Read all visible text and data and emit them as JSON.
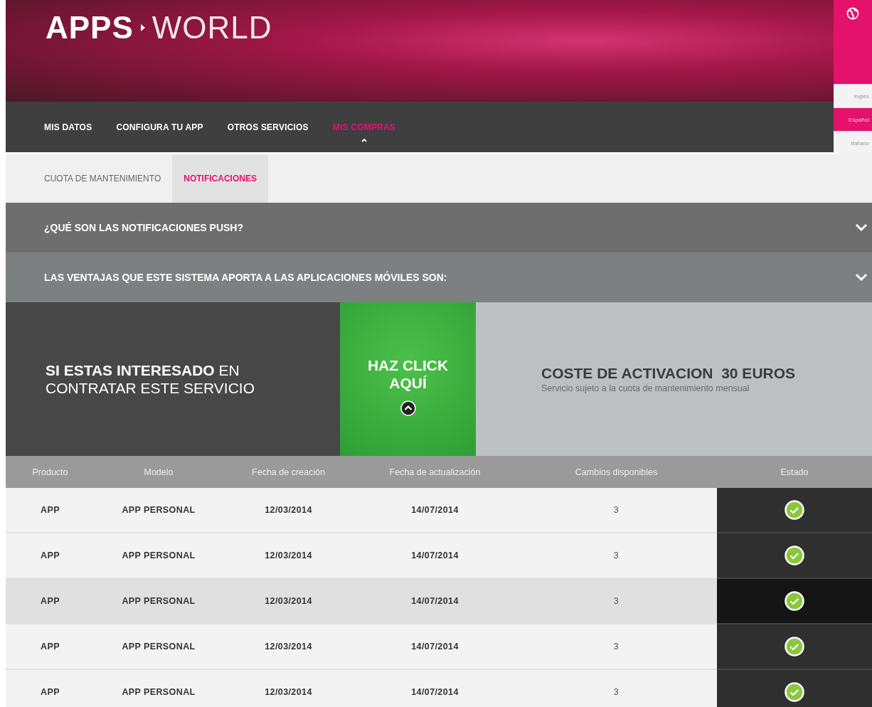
{
  "header": {
    "logo_bold": "APPS",
    "logo_light": "WORLD"
  },
  "languages": [
    {
      "label": "Inglés",
      "selected": false
    },
    {
      "label": "Español",
      "selected": true
    },
    {
      "label": "Italiano",
      "selected": false
    }
  ],
  "nav": [
    {
      "label": "MIS DATOS",
      "selected": false
    },
    {
      "label": "CONFIGURA TU APP",
      "selected": false
    },
    {
      "label": "OTROS SERVICIOS",
      "selected": false
    },
    {
      "label": "MIS COMPRAS",
      "selected": true
    }
  ],
  "subtabs": [
    {
      "label": "CUOTA DE MANTENIMIENTO",
      "selected": false
    },
    {
      "label": "NOTIFICACIONES",
      "selected": true
    }
  ],
  "accordions": [
    {
      "title": "¿QUÉ SON LAS NOTIFICACIONES PUSH?",
      "expanded": false
    },
    {
      "title": "LAS VENTAJAS QUE ESTE SISTEMA APORTA A LAS APLICACIONES MÓVILES SON:",
      "expanded": false
    }
  ],
  "promo": {
    "message": "**SI ESTAS INTERESADO** EN CONTRATAR ESTE SERVICIO",
    "cta": "HAZ CLICK AQUÍ",
    "price_title": "COSTE DE ACTIVACION  30 EUROS",
    "price_note": "Servicio sujeto a la cuota de mantenimiento mensual"
  },
  "table": {
    "columns": [
      "Producto",
      "Modelo",
      "Fecha de creación",
      "Fecha de actualización",
      "Cambios disponibles",
      "Estado"
    ],
    "rows": [
      {
        "cells": [
          "APP",
          "APP PERSONAL",
          "12/03/2014",
          "14/07/2014",
          "3"
        ],
        "selected": false
      },
      {
        "cells": [
          "APP",
          "APP PERSONAL",
          "12/03/2014",
          "14/07/2014",
          "3"
        ],
        "selected": false
      },
      {
        "cells": [
          "APP",
          "APP PERSONAL",
          "12/03/2014",
          "14/07/2014",
          "3"
        ],
        "selected": true
      },
      {
        "cells": [
          "APP",
          "APP PERSONAL",
          "12/03/2014",
          "14/07/2014",
          "3"
        ],
        "selected": false
      },
      {
        "cells": [
          "APP",
          "APP PERSONAL",
          "12/03/2014",
          "14/07/2014",
          "3"
        ],
        "selected": false
      }
    ]
  }
}
